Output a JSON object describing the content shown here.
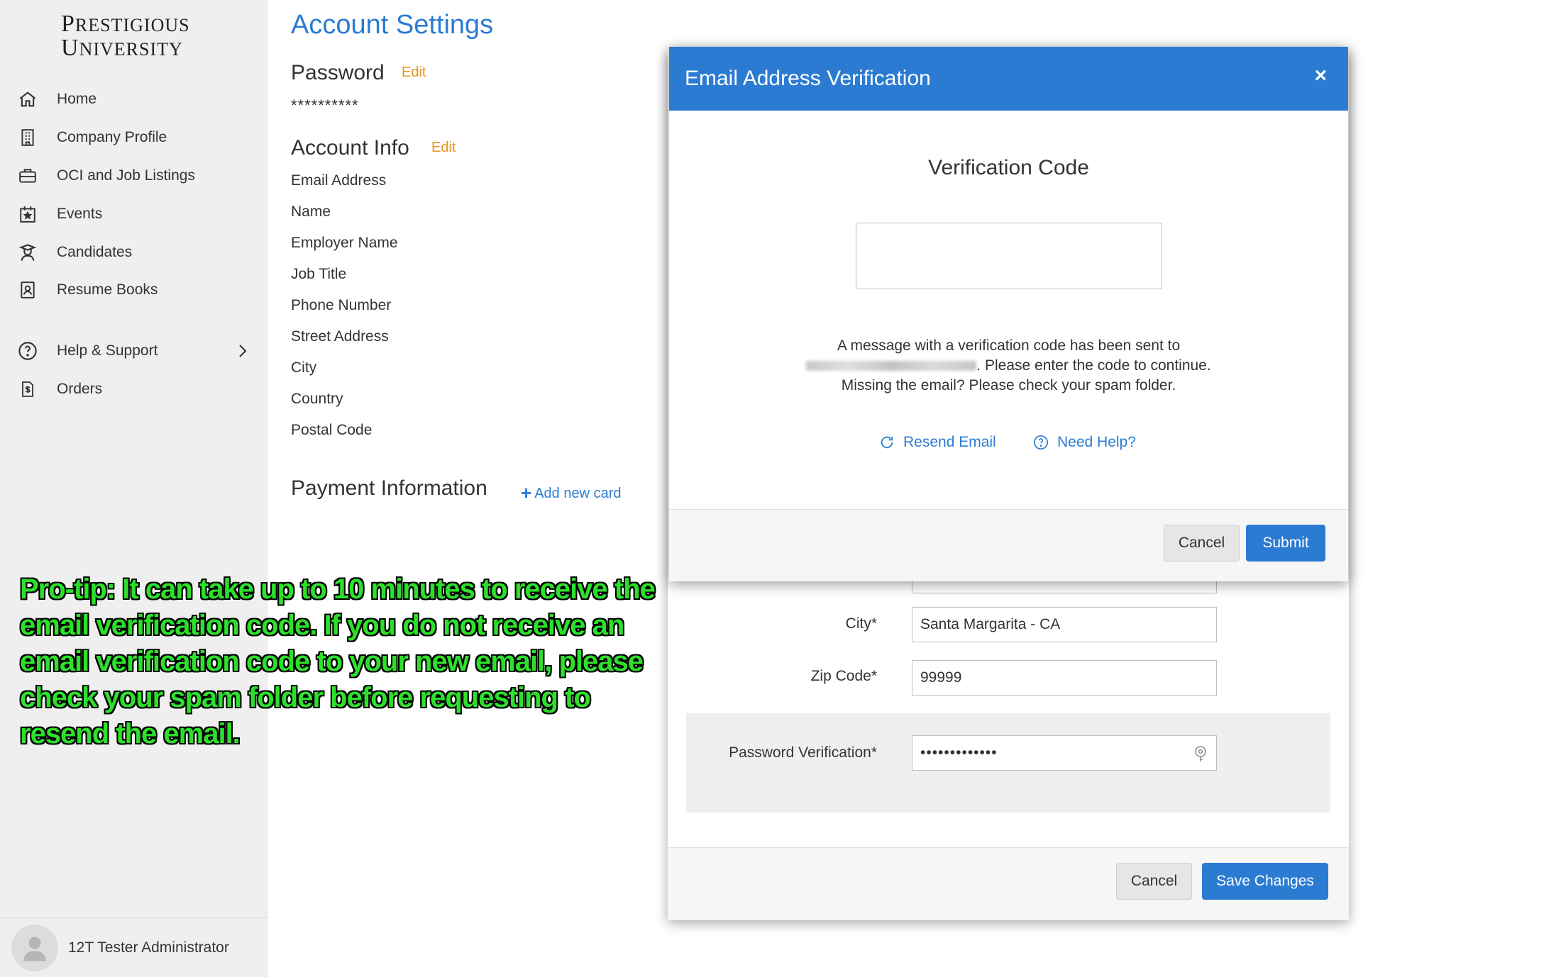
{
  "logo": {
    "line1": "PRESTIGIOUS",
    "line2": "UNIVERSITY"
  },
  "sidebar": {
    "items": [
      {
        "label": "Home",
        "icon": "home-icon"
      },
      {
        "label": "Company Profile",
        "icon": "building-icon"
      },
      {
        "label": "OCI and Job Listings",
        "icon": "briefcase-icon"
      },
      {
        "label": "Events",
        "icon": "calendar-icon"
      },
      {
        "label": "Candidates",
        "icon": "graduate-icon"
      },
      {
        "label": "Resume Books",
        "icon": "contact-book-icon"
      },
      {
        "label": "Help & Support",
        "icon": "question-circle-icon"
      },
      {
        "label": "Orders",
        "icon": "receipt-icon"
      }
    ],
    "user": "12T Tester Administrator"
  },
  "main": {
    "title": "Account Settings",
    "password": {
      "title": "Password",
      "edit": "Edit",
      "mask": "**********"
    },
    "account_info": {
      "title": "Account Info",
      "edit": "Edit",
      "fields": [
        "Email Address",
        "Name",
        "Employer Name",
        "Job Title",
        "Phone Number",
        "Street Address",
        "City",
        "Country",
        "Postal Code"
      ]
    },
    "payment": {
      "title": "Payment Information",
      "add_card": "Add new card"
    }
  },
  "pro_tip": "Pro-tip: It can take up to 10 minutes to receive the email verification code. If you do not receive an email verification code to your new email, please check your spam folder before requesting to resend the email.",
  "edit_modal": {
    "city_label": "City*",
    "city_value": "Santa Margarita - CA",
    "zip_label": "Zip Code*",
    "zip_value": "99999",
    "password_label": "Password Verification*",
    "password_value": "•••••••••••••",
    "cancel": "Cancel",
    "save": "Save Changes"
  },
  "verify_modal": {
    "title": "Email Address Verification",
    "close": "×",
    "heading": "Verification Code",
    "code_value": "",
    "message_line1": "A message with a verification code has been sent to",
    "message_line2_suffix": ". Please enter the code to continue.",
    "message_line3": "Missing the email? Please check your spam folder.",
    "resend": "Resend Email",
    "help": "Need Help?",
    "cancel": "Cancel",
    "submit": "Submit"
  },
  "colors": {
    "accent": "#2b7bd3",
    "edit": "#e8931c",
    "tip": "#2de02b",
    "sidebar": "#efefef"
  }
}
